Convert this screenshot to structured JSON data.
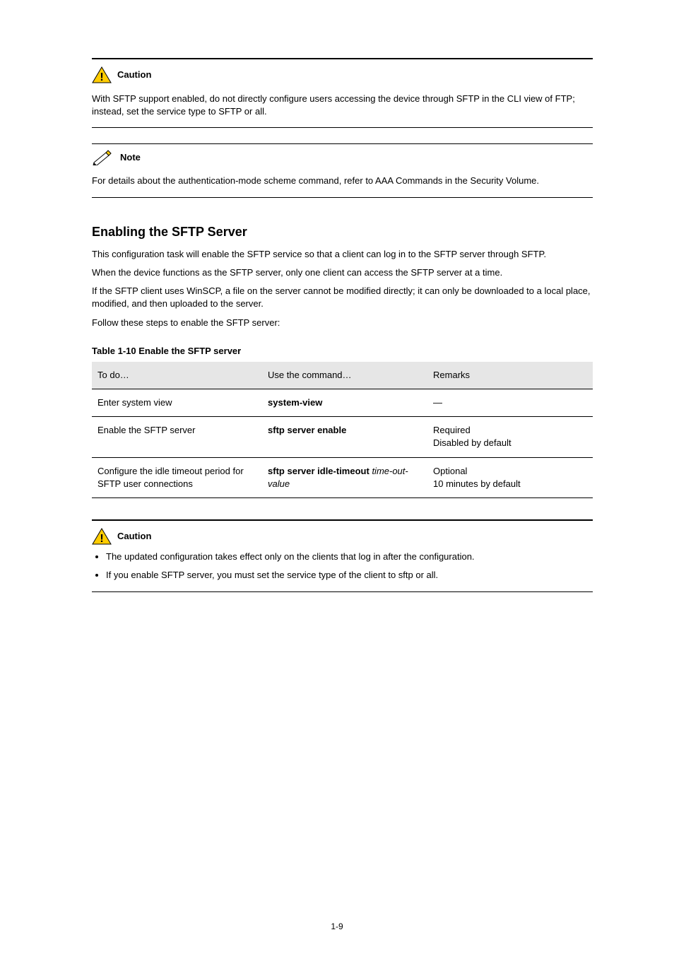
{
  "callouts": {
    "caution1": {
      "label": "Caution",
      "body": "With SFTP support enabled, do not directly configure users accessing the device through SFTP in the CLI view of FTP; instead, set the service type to SFTP or all."
    },
    "note1": {
      "label": "Note",
      "body": "For details about the authentication-mode scheme command, refer to AAA Commands in the Security Volume."
    },
    "caution2": {
      "label": "Caution",
      "bullets": [
        "The updated configuration takes effect only on the clients that log in after the configuration.",
        "If you enable SFTP server, you must set the service type of the client to sftp or all."
      ]
    }
  },
  "section": {
    "heading": "Enabling the SFTP Server",
    "intro": "This configuration task will enable the SFTP service so that a client can log in to the SFTP server through SFTP.",
    "note_line_1": "When the device functions as the SFTP server, only one client can access the SFTP server at a time.",
    "note_line_2": "If the SFTP client uses WinSCP, a file on the server cannot be modified directly; it can only be downloaded to a local place, modified, and then uploaded to the server.",
    "procedure": "Follow these steps to enable the SFTP server:"
  },
  "table": {
    "caption": "Table 1-10 Enable the SFTP server",
    "headers": [
      "To do…",
      "Use the command…",
      "Remarks"
    ],
    "rows": [
      {
        "todo": "Enter system view",
        "cmd": "system-view",
        "remarks": "—"
      },
      {
        "todo": "Enable the SFTP server",
        "cmd": "sftp server enable",
        "remarks": "Required\nDisabled by default"
      },
      {
        "todo": "Configure the idle timeout period for SFTP user connections",
        "cmd_parts": [
          {
            "text": "sftp server idle-timeout",
            "bold": true
          },
          {
            "text": " ",
            "bold": false
          },
          {
            "text": "time-out-value",
            "italic": true
          }
        ],
        "remarks": "Optional\n10 minutes by default"
      }
    ]
  },
  "page_number": "1-9"
}
